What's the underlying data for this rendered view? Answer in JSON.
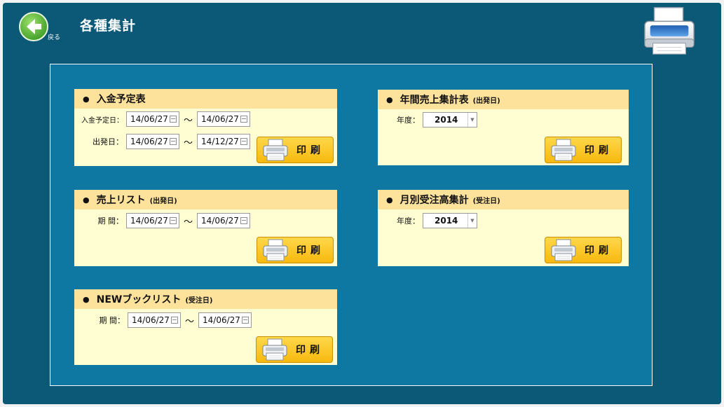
{
  "header": {
    "back_label": "戻る",
    "title": "各種集計"
  },
  "panels": {
    "nyukin": {
      "title": "入金予定表",
      "rows": [
        {
          "label": "入金予定日：",
          "from": "14/06/27",
          "to": "14/06/27"
        },
        {
          "label": "出発日：",
          "from": "14/06/27",
          "to": "14/12/27"
        }
      ],
      "print_label": "印刷"
    },
    "uriage": {
      "title": "売上リスト",
      "subtitle": "(出発日)",
      "rows": [
        {
          "label": "期 間：",
          "from": "14/06/27",
          "to": "14/06/27"
        }
      ],
      "print_label": "印刷"
    },
    "newbook": {
      "title": "NEWブックリスト",
      "subtitle": "(受注日)",
      "rows": [
        {
          "label": "期 間：",
          "from": "14/06/27",
          "to": "14/06/27"
        }
      ],
      "print_label": "印刷"
    },
    "nenkan": {
      "title": "年間売上集計表",
      "subtitle": "(出発日)",
      "year_label": "年度：",
      "year_value": "2014",
      "print_label": "印刷"
    },
    "getsubetsu": {
      "title": "月別受注高集計",
      "subtitle": "(受注日)",
      "year_label": "年度：",
      "year_value": "2014",
      "print_label": "印刷"
    }
  },
  "common": {
    "tilde": "〜",
    "bullet": "●"
  },
  "icons": {
    "back": "arrow-left-circle-icon",
    "printer": "printer-icon"
  },
  "colors": {
    "background": "#0b5877",
    "content": "#0f78a2",
    "panel_header": "#fde29b",
    "panel_body": "#fffdd2",
    "print_button": "#f7b90e",
    "back_button": "#6cc24a"
  }
}
